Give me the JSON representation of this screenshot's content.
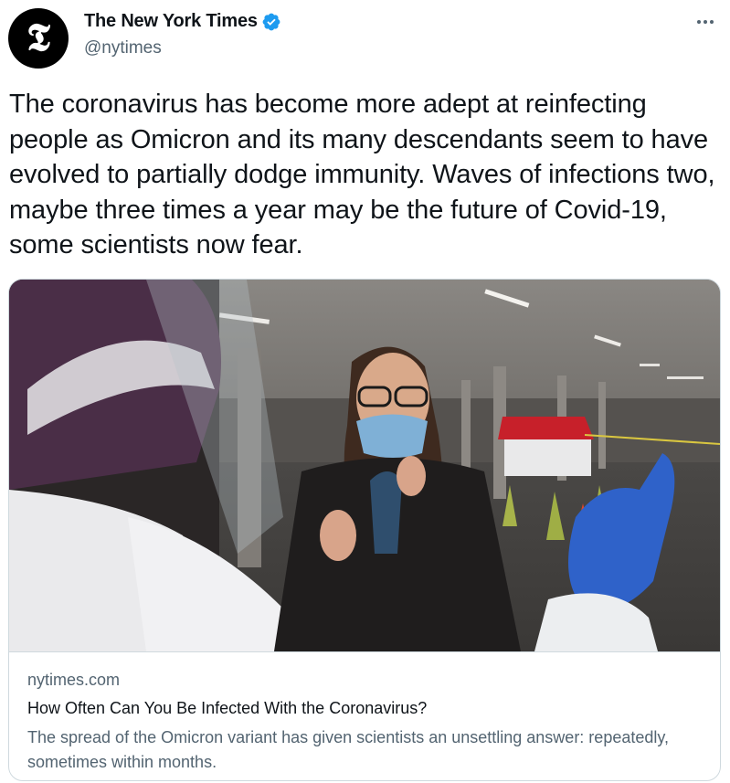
{
  "author": {
    "display_name": "The New York Times",
    "handle": "@nytimes",
    "avatar_glyph": "𝕿",
    "verified": true,
    "verified_color": "#1d9bf0"
  },
  "tweet": {
    "text": "The coronavirus has become more adept at reinfecting people as Omicron and its many descendants seem to have evolved to partially dodge immunity. Waves of infections two, maybe three times a year may be the future of Covid-19, some scientists now fear."
  },
  "card": {
    "domain": "nytimes.com",
    "title": "How Often Can You Be Infected With the Coronavirus?",
    "description": "The spread of the Omicron variant has given scientists an unsettling answer: repeatedly, sometimes within months."
  },
  "colors": {
    "text": "#0f1419",
    "secondary": "#536471",
    "border": "#cfd9de"
  },
  "icons": [
    "more-icon",
    "verified-badge-icon"
  ]
}
